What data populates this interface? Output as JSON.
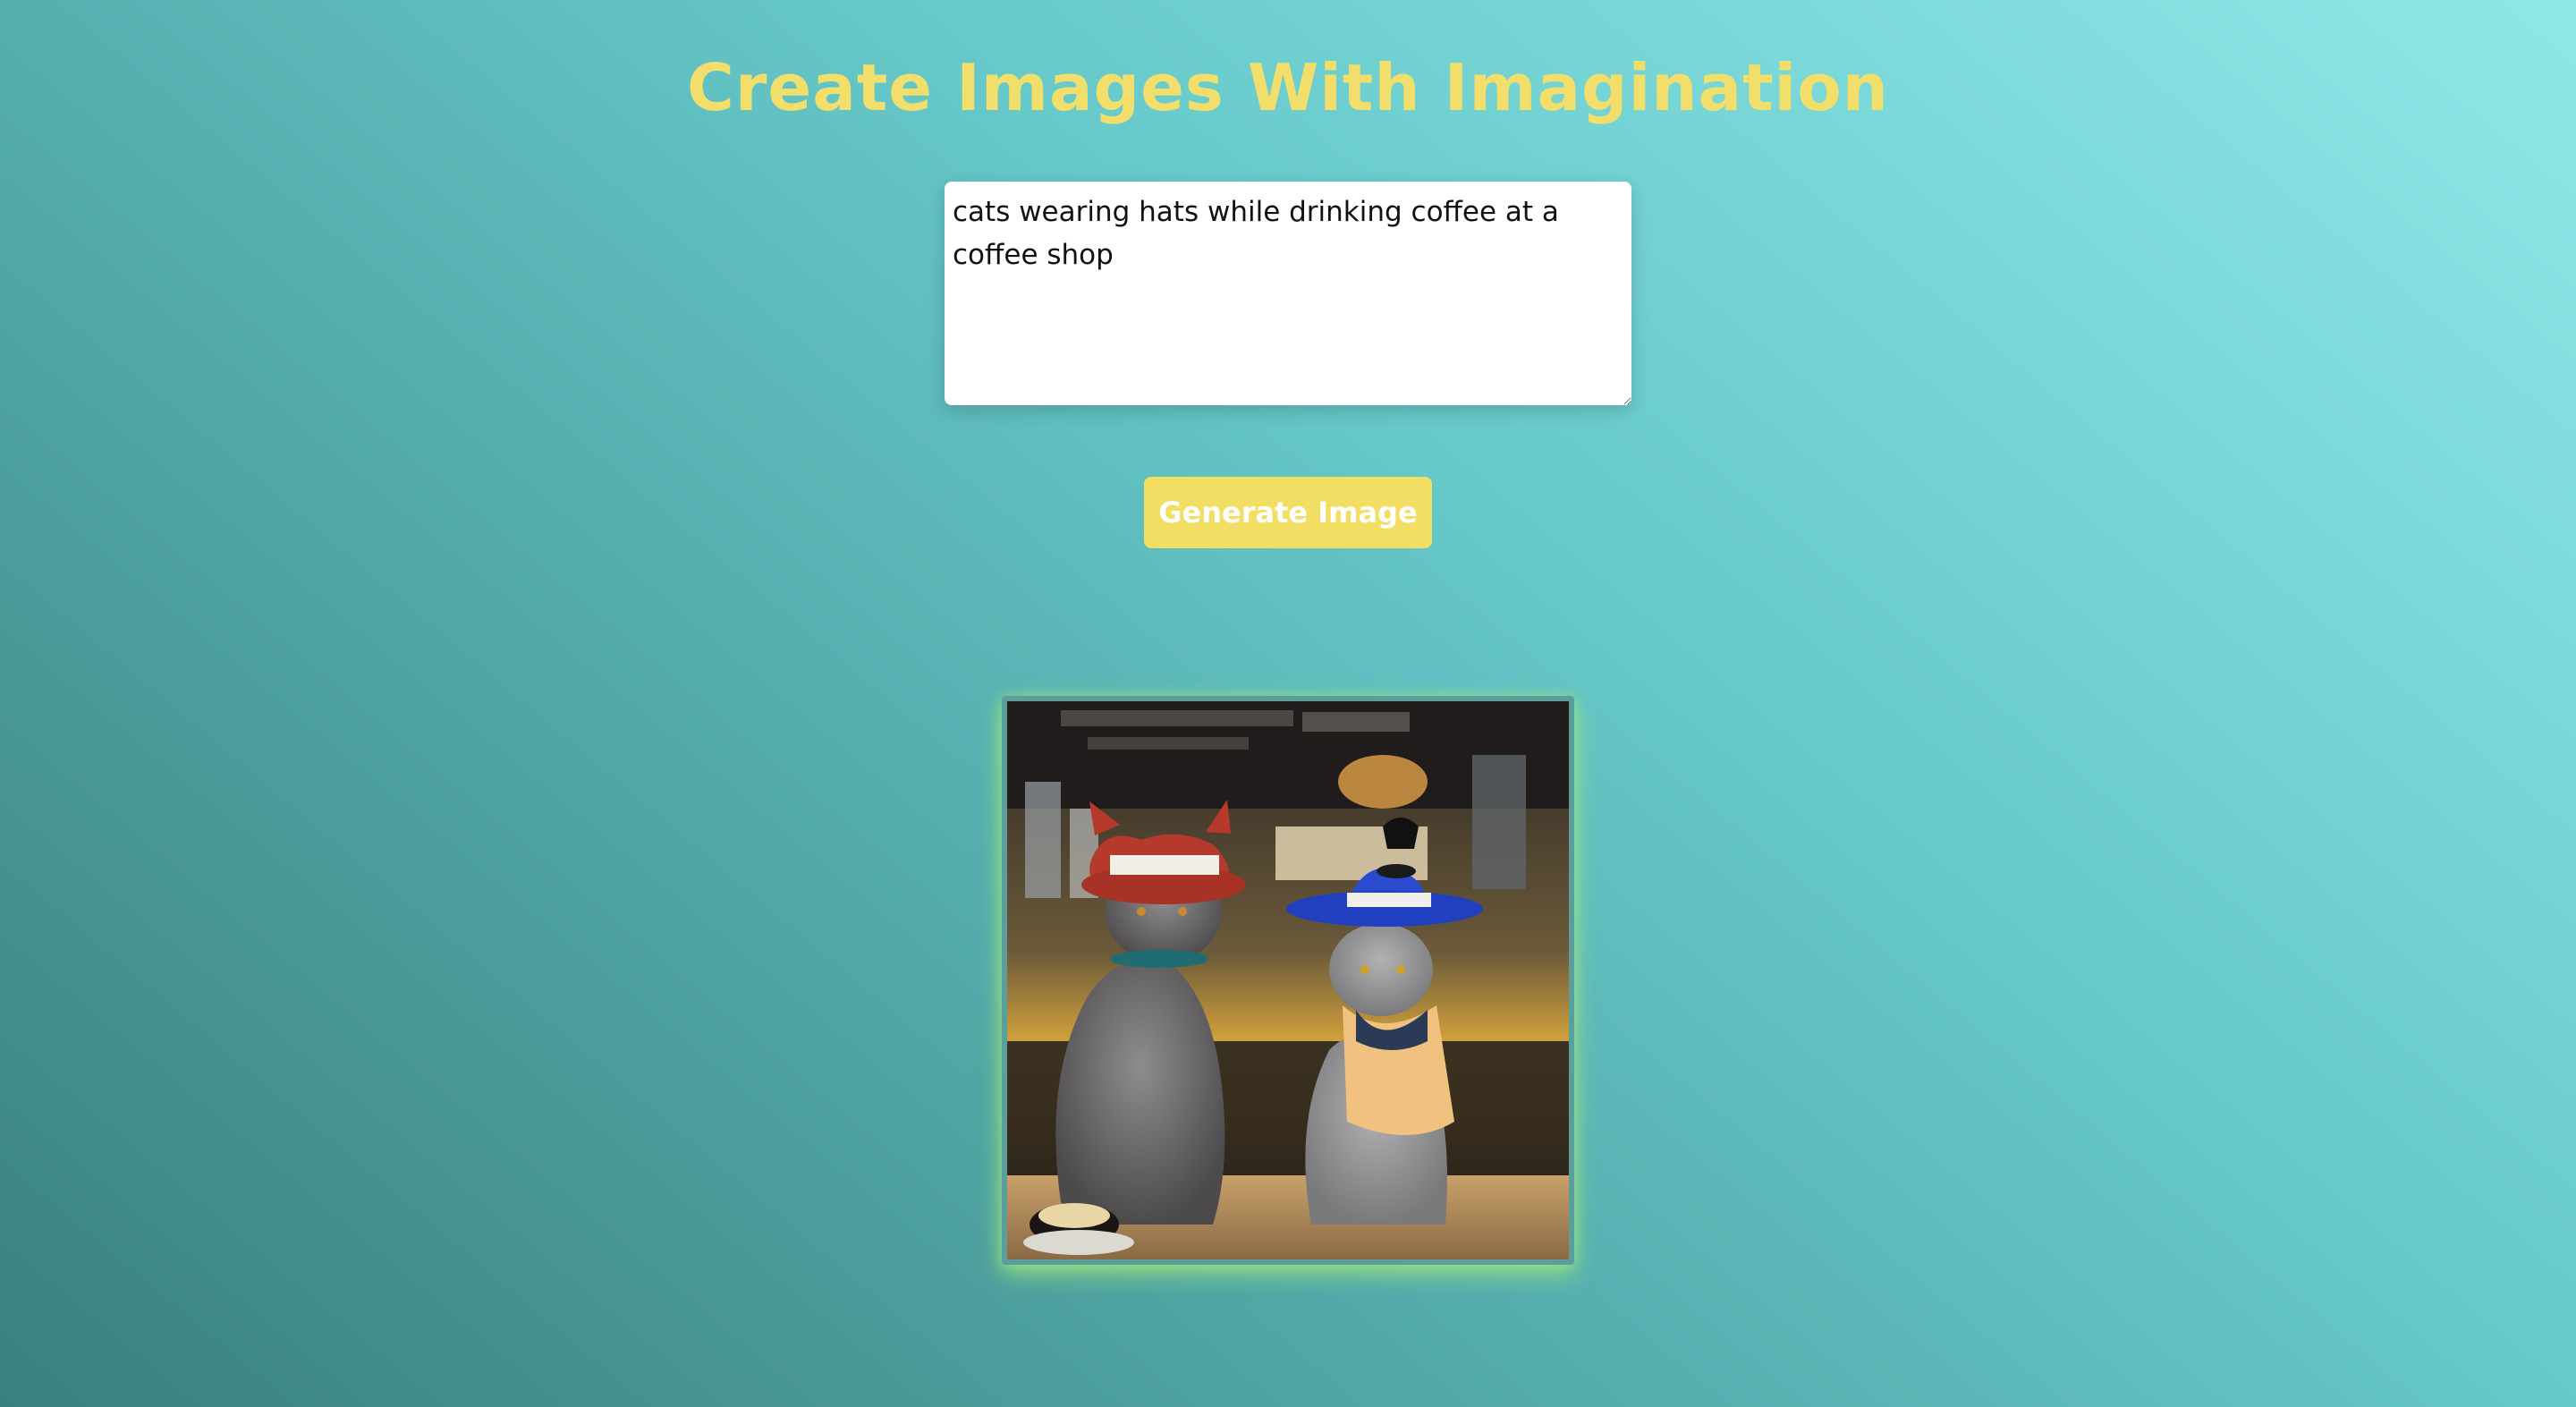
{
  "header": {
    "title": "Create Images With Imagination"
  },
  "prompt": {
    "value": "cats wearing hats while drinking coffee at a coffee shop",
    "placeholder": ""
  },
  "actions": {
    "generate_label": "Generate Image"
  },
  "result": {
    "image_icon": "generated-image",
    "subject": "cats wearing hats while drinking coffee at a coffee shop"
  },
  "colors": {
    "title": "#f2df6b",
    "button_bg": "#f2de63",
    "button_text": "#ffffff",
    "glow": "#a6ee78"
  }
}
